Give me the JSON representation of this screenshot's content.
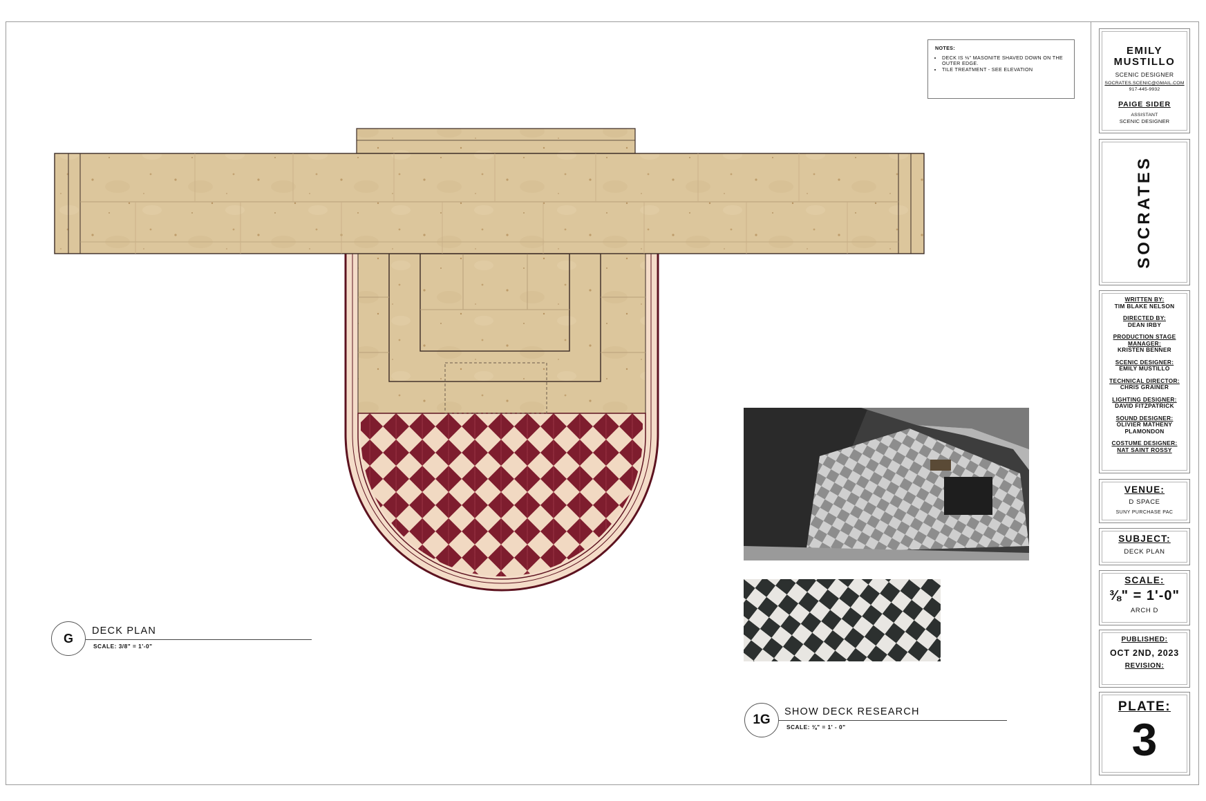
{
  "notes": {
    "title": "NOTES:",
    "items": [
      "DECK IS ⅛\" MASONITE SHAVED DOWN ON THE OUTER EDGE.",
      "TILE TREATMENT - SEE ELEVATION"
    ]
  },
  "designer": {
    "name_line1": "EMILY",
    "name_line2": "MUSTILLO",
    "role": "SCENIC DESIGNER",
    "email": "SOCRATES.SCENIC@GMAIL.COM",
    "phone": "917-445-9932",
    "assistant_name": "PAIGE SIDER",
    "assistant_role_line1": "ASSISTANT",
    "assistant_role_line2": "SCENIC DESIGNER"
  },
  "show_title": "SOCRATES",
  "credits": [
    {
      "label": "WRITTEN BY:",
      "value": "TIM BLAKE NELSON"
    },
    {
      "label": "DIRECTED BY:",
      "value": "DEAN IRBY"
    },
    {
      "label": "PRODUCTION STAGE MANAGER:",
      "value": "KRISTEN BENNER"
    },
    {
      "label": "SCENIC DESIGNER:",
      "value": "EMILY MUSTILLO"
    },
    {
      "label": "TECHNICAL DIRECTOR:",
      "value": "CHRIS GRAINER"
    },
    {
      "label": "LIGHTING DESIGNER:",
      "value": "DAVID FITZPATRICK"
    },
    {
      "label": "SOUND DESIGNER:",
      "value": "OLIVIER MATHENY PLAMONDON"
    },
    {
      "label": "COSTUME DESIGNER:",
      "value": "NAT SAINT ROSSY"
    }
  ],
  "venue": {
    "heading": "VENUE:",
    "name": "D SPACE",
    "location": "SUNY PURCHASE PAC"
  },
  "subject": {
    "heading": "SUBJECT:",
    "value": "DECK PLAN"
  },
  "scale": {
    "heading": "SCALE:",
    "value": "⅜\" = 1'-0\"",
    "sheet": "ARCH D"
  },
  "published": {
    "heading": "PUBLISHED:",
    "date": "OCT 2ND, 2023",
    "revision_label": "REVISION:"
  },
  "plate": {
    "heading": "PLATE:",
    "number": "3"
  },
  "drawing_g": {
    "id": "G",
    "title": "DECK PLAN",
    "scale": "SCALE: 3/8\" = 1'-0\""
  },
  "drawing_1g": {
    "id": "1G",
    "title": "SHOW DECK RESEARCH",
    "scale": "SCALE: ⅜\" = 1' - 0\""
  },
  "colors": {
    "stone": "#dcc69c",
    "stone_dark": "#cdb48a",
    "tile_red": "#7e1d2e",
    "tile_cream": "#f2dcc6",
    "border_ring": "#f4dcc8",
    "outline": "#3a2a24"
  }
}
